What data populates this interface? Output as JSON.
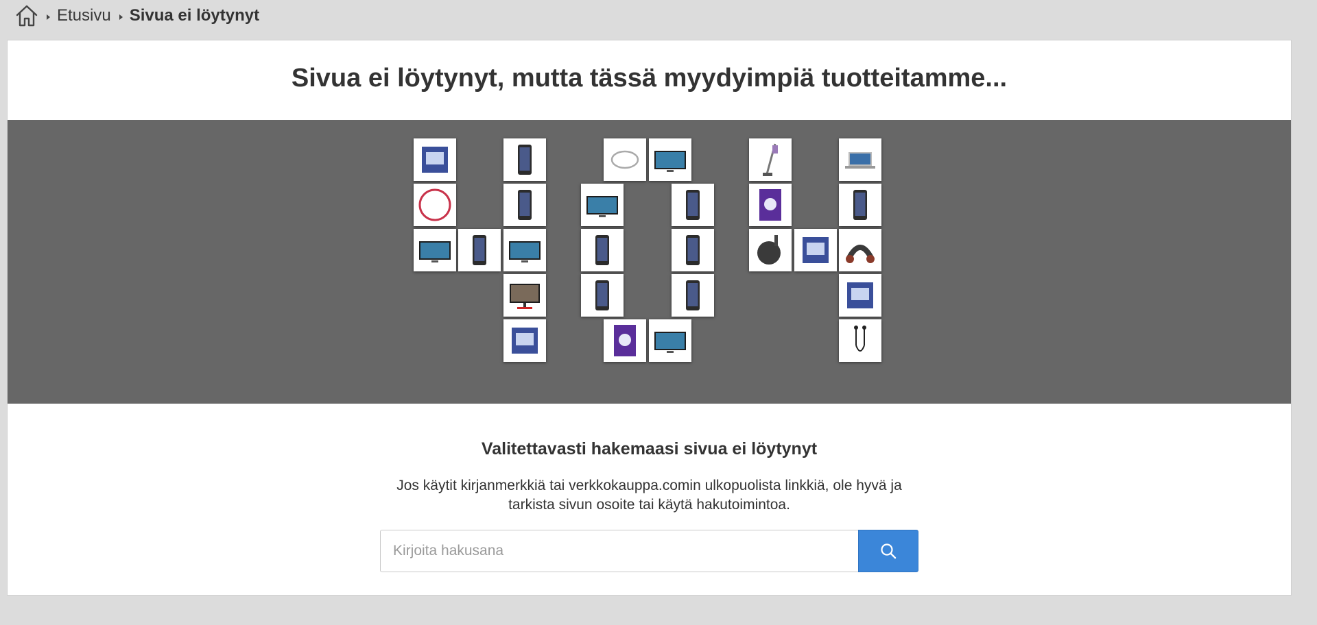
{
  "breadcrumb": {
    "home_icon": "home-icon",
    "items": [
      "Etusivu",
      "Sivua ei löytynyt"
    ]
  },
  "page": {
    "title": "Sivua ei löytynyt, mutta tässä myydyimpiä tuotteitamme...",
    "subtitle": "Valitettavasti hakemaasi sivua ei löytynyt",
    "body": "Jos käytit kirjanmerkkiä tai verkkokauppa.comin ulkopuolista linkkiä, ole hyvä ja tarkista sivun osoite tai käytä hakutoimintoa."
  },
  "search": {
    "placeholder": "Kirjoita hakusana",
    "value": "",
    "button_icon": "search-icon"
  },
  "colors": {
    "page_background": "#dcdcdc",
    "banner_background": "#676767",
    "search_button": "#3b86d9",
    "text": "#333333"
  },
  "product_tiles": [
    {
      "name": "product-home-automation-kit",
      "icon": "device-box-icon"
    },
    {
      "name": "product-smartphone-black",
      "icon": "smartphone-icon"
    },
    {
      "name": "product-bracelet",
      "icon": "bracelet-icon"
    },
    {
      "name": "product-tv",
      "icon": "tv-icon"
    },
    {
      "name": "product-stick-vacuum",
      "icon": "vacuum-icon"
    },
    {
      "name": "product-laptop",
      "icon": "laptop-icon"
    },
    {
      "name": "product-hula-hoop",
      "icon": "hoop-icon"
    },
    {
      "name": "product-smartphone-grey",
      "icon": "smartphone-icon"
    },
    {
      "name": "product-4k-tv",
      "icon": "tv-icon"
    },
    {
      "name": "product-iphone-pro",
      "icon": "smartphone-icon"
    },
    {
      "name": "product-switch-game",
      "icon": "game-case-icon"
    },
    {
      "name": "product-smartphone-blue",
      "icon": "smartphone-icon"
    },
    {
      "name": "product-tv-small",
      "icon": "tv-icon"
    },
    {
      "name": "product-phone-pink",
      "icon": "smartphone-icon"
    },
    {
      "name": "product-tv-offer",
      "icon": "tv-icon"
    },
    {
      "name": "product-galaxy-purple",
      "icon": "smartphone-icon"
    },
    {
      "name": "product-galaxy-blue",
      "icon": "smartphone-icon"
    },
    {
      "name": "product-chromecast",
      "icon": "dongle-icon"
    },
    {
      "name": "product-console-bundle",
      "icon": "device-box-icon"
    },
    {
      "name": "product-neck-massager",
      "icon": "massager-icon"
    },
    {
      "name": "product-monitor",
      "icon": "monitor-icon"
    },
    {
      "name": "product-iphone-green",
      "icon": "smartphone-icon"
    },
    {
      "name": "product-galaxy-a10",
      "icon": "smartphone-icon"
    },
    {
      "name": "product-tv-bundle",
      "icon": "device-box-icon"
    },
    {
      "name": "product-vr-headset-box",
      "icon": "device-box-icon"
    },
    {
      "name": "product-ps4-game",
      "icon": "game-case-icon"
    },
    {
      "name": "product-uhd-tv",
      "icon": "tv-icon"
    },
    {
      "name": "product-earphones",
      "icon": "earphones-icon"
    }
  ]
}
